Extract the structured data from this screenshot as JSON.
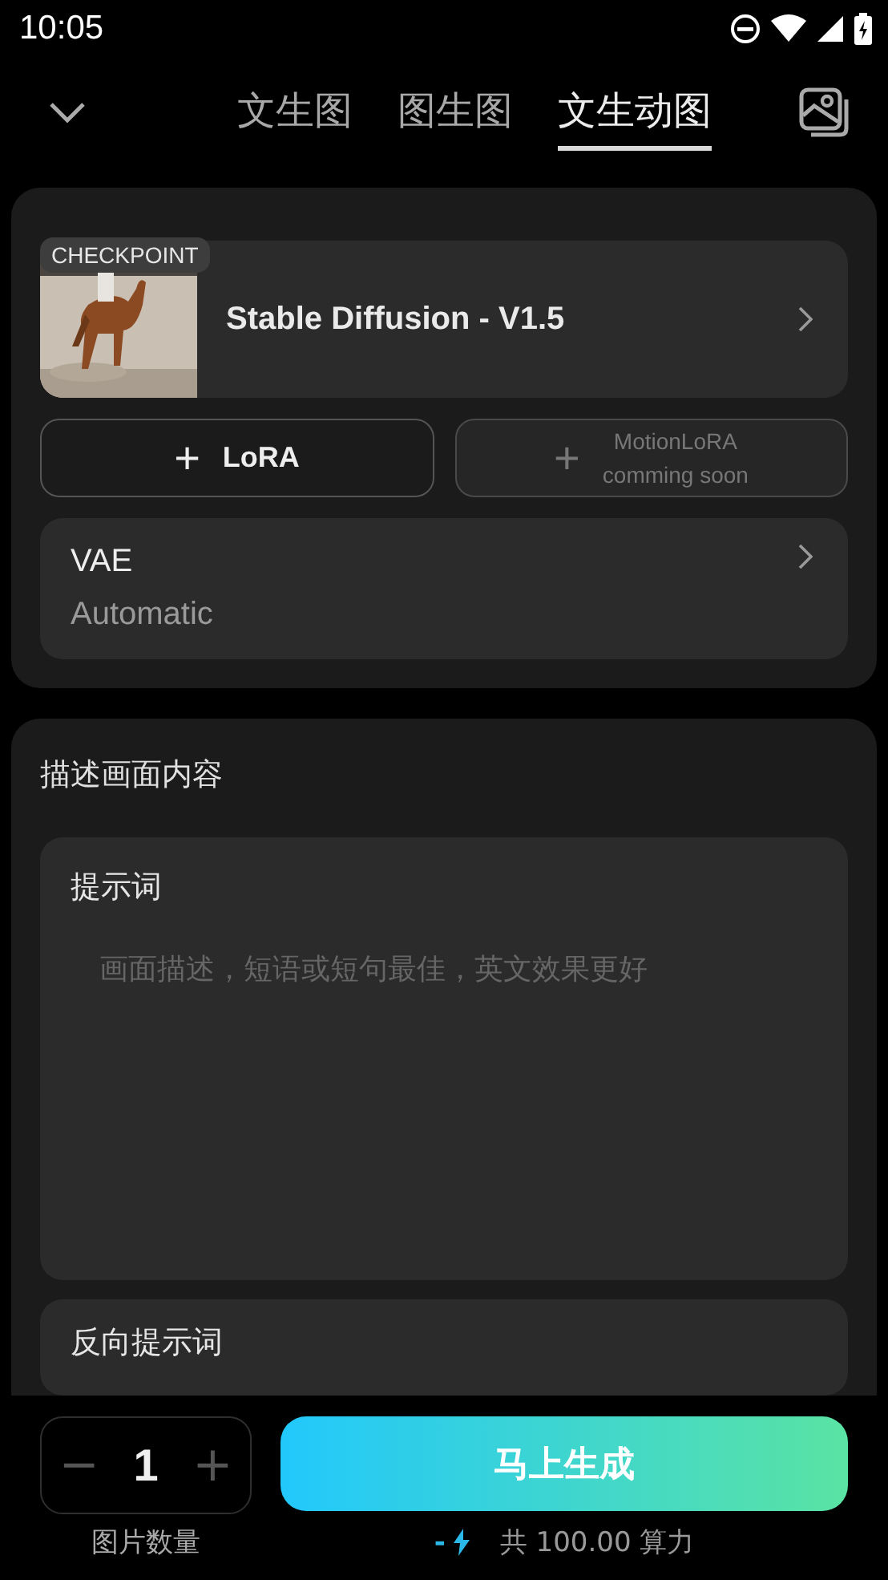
{
  "status_bar": {
    "time": "10:05"
  },
  "tabs": [
    {
      "label": "文生图",
      "selected": false
    },
    {
      "label": "图生图",
      "selected": false
    },
    {
      "label": "文生动图",
      "selected": true
    }
  ],
  "model": {
    "badge": "CHECKPOINT",
    "name": "Stable Diffusion - V1.5"
  },
  "add_buttons": [
    {
      "icon": "+",
      "label": "LoRA",
      "disabled": false
    },
    {
      "icon": "+",
      "label": "MotionLoRA",
      "note": "comming soon",
      "disabled": true
    }
  ],
  "vae": {
    "label": "VAE",
    "value": "Automatic"
  },
  "describe": {
    "title": "描述画面内容",
    "prompt": {
      "label": "提示词",
      "placeholder": "画面描述，短语或短句最佳，英文效果更好"
    },
    "negative": {
      "label": "反向提示词"
    }
  },
  "bottom": {
    "count": {
      "minus": "−",
      "value": "1",
      "plus": "+",
      "label": "图片数量"
    },
    "generate": "马上生成",
    "cost": {
      "sign": "-",
      "text": "共 100.00 算力"
    }
  }
}
